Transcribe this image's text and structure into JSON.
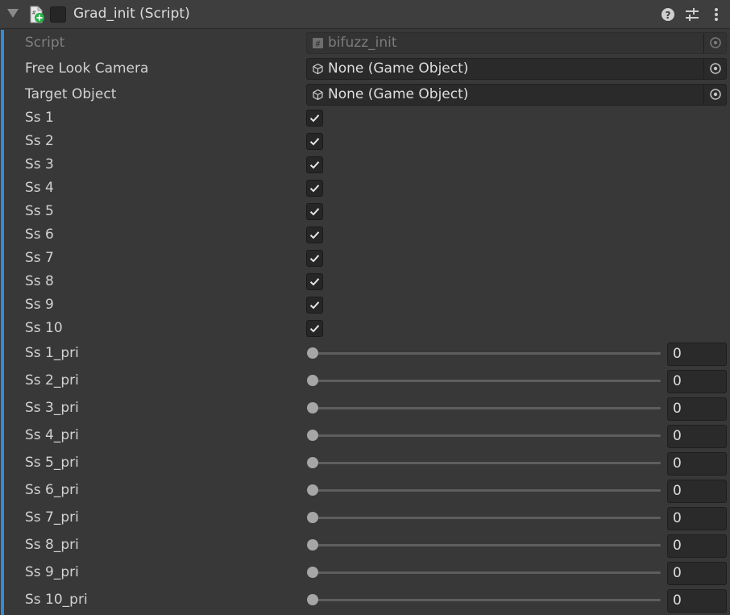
{
  "component": {
    "title": "Grad_init (Script)",
    "icons": [
      "fold-triangle-icon",
      "script-icon",
      "help-icon",
      "presets-icon",
      "kebab-menu-icon"
    ]
  },
  "script_field": {
    "label": "Script",
    "value": "bifuzz_init"
  },
  "object_fields": [
    {
      "label": "Free Look Camera",
      "value": "None (Game Object)"
    },
    {
      "label": "Target Object",
      "value": "None (Game Object)"
    }
  ],
  "toggles": [
    {
      "label": "Ss 1",
      "checked": true
    },
    {
      "label": "Ss 2",
      "checked": true
    },
    {
      "label": "Ss 3",
      "checked": true
    },
    {
      "label": "Ss 4",
      "checked": true
    },
    {
      "label": "Ss 5",
      "checked": true
    },
    {
      "label": "Ss 6",
      "checked": true
    },
    {
      "label": "Ss 7",
      "checked": true
    },
    {
      "label": "Ss 8",
      "checked": true
    },
    {
      "label": "Ss 9",
      "checked": true
    },
    {
      "label": "Ss 10",
      "checked": true
    }
  ],
  "sliders": [
    {
      "label": "Ss 1_pri",
      "value": "0",
      "level": 0
    },
    {
      "label": "Ss 2_pri",
      "value": "0",
      "level": 0
    },
    {
      "label": "Ss 3_pri",
      "value": "0",
      "level": 0
    },
    {
      "label": "Ss 4_pri",
      "value": "0",
      "level": 0
    },
    {
      "label": "Ss 5_pri",
      "value": "0",
      "level": 0
    },
    {
      "label": "Ss 6_pri",
      "value": "0",
      "level": 0
    },
    {
      "label": "Ss 7_pri",
      "value": "0",
      "level": 0
    },
    {
      "label": "Ss 8_pri",
      "value": "0",
      "level": 0
    },
    {
      "label": "Ss 9_pri",
      "value": "0",
      "level": 0
    },
    {
      "label": "Ss 10_pri",
      "value": "0",
      "level": 0
    }
  ],
  "colors": {
    "accent": "#2f8ddb",
    "background": "#383838",
    "field": "#2a2a2a"
  }
}
